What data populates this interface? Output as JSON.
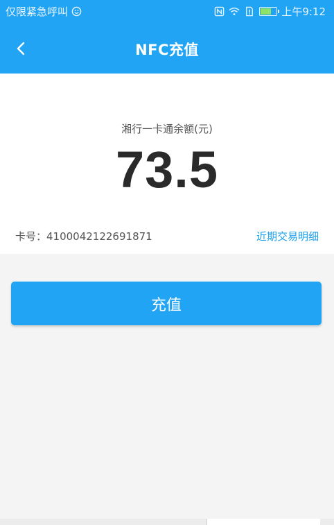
{
  "status_bar": {
    "carrier_text": "仅限紧急呼叫",
    "time": "上午9:12",
    "icons": [
      "emoji-icon",
      "nfc-icon",
      "wifi-icon",
      "sim-icon",
      "battery-icon"
    ],
    "battery_level": 0.6
  },
  "appbar": {
    "title": "NFC充值",
    "back_icon": "chevron-left-icon"
  },
  "balance": {
    "label": "湘行一卡通余额(元)",
    "value": "73.5"
  },
  "card": {
    "number_text": "卡号：4100042122691871",
    "recent_link": "近期交易明细"
  },
  "action": {
    "recharge_label": "充值"
  },
  "colors": {
    "primary": "#22a4f5",
    "link": "#1ba0ea",
    "background": "#f4f4f4",
    "text_dark": "#2a2a2a"
  }
}
